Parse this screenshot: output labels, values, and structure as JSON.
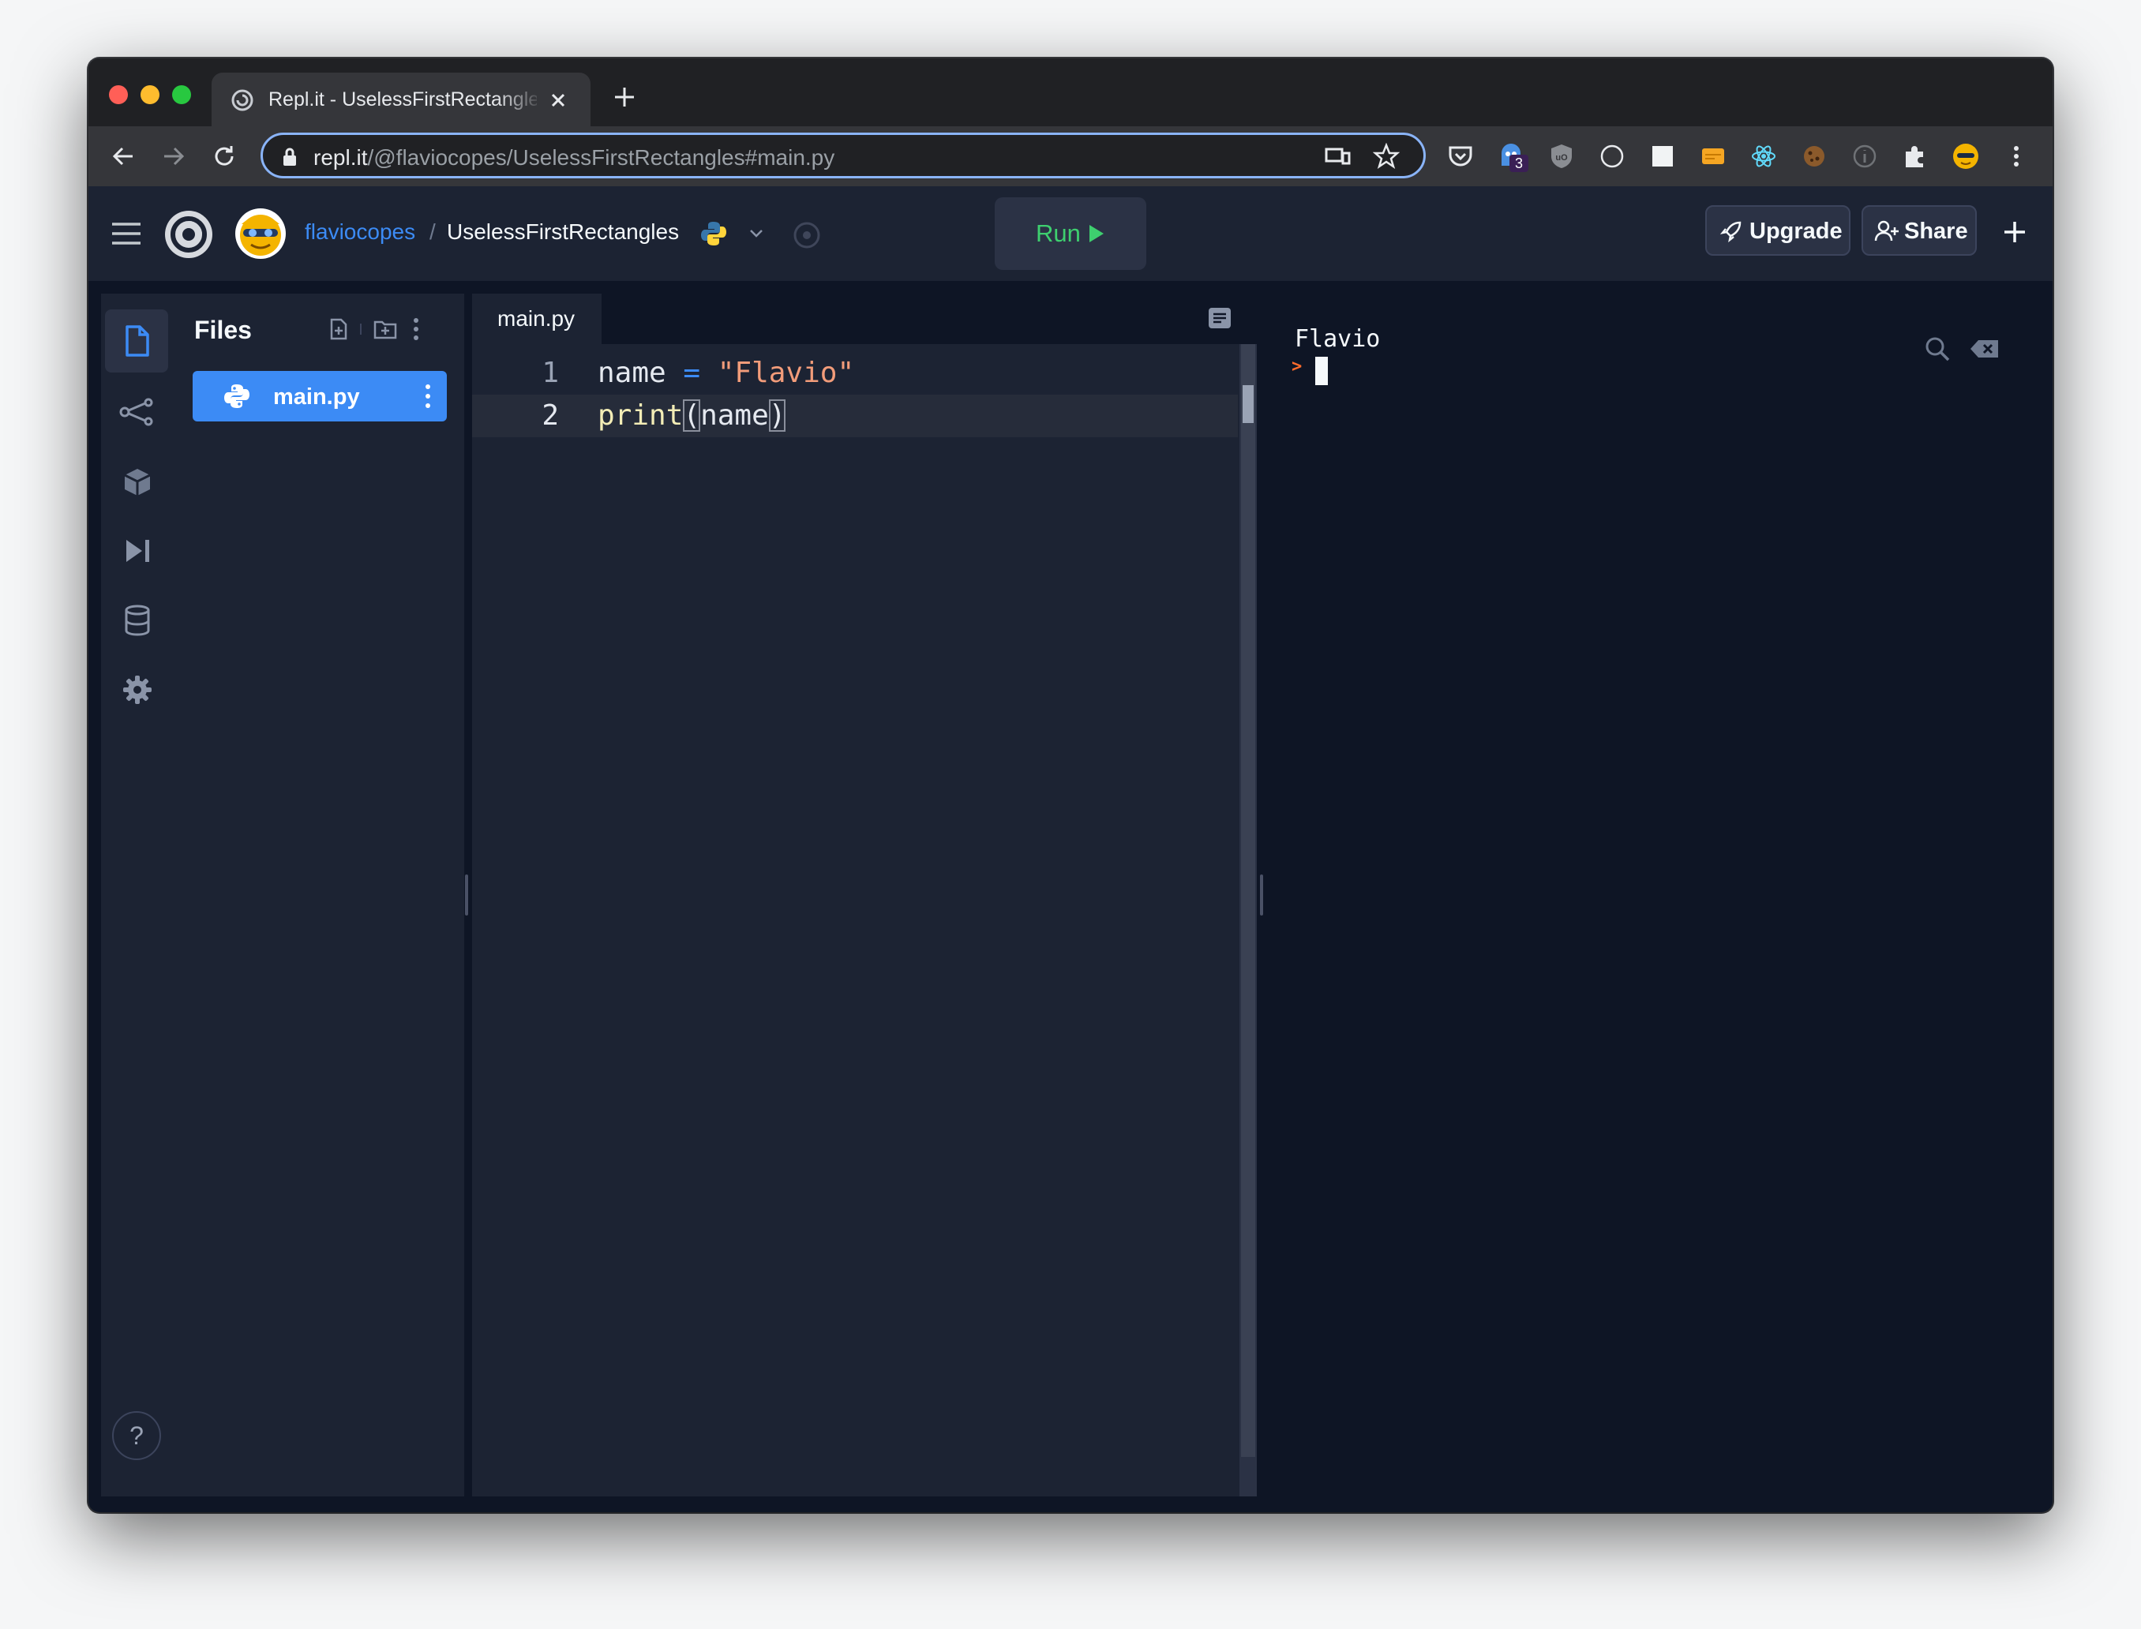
{
  "browser": {
    "tab_title": "Repl.it - UselessFirstRectangles",
    "url_host": "repl.it",
    "url_path": "/@flaviocopes/UselessFirstRectangles#main.py",
    "extension_badge": "3"
  },
  "header": {
    "owner": "flaviocopes",
    "separator": "/",
    "repl_name": "UselessFirstRectangles",
    "run_label": "Run",
    "upgrade_label": "Upgrade",
    "share_label": "Share"
  },
  "files_panel": {
    "title": "Files",
    "files": [
      {
        "name": "main.py",
        "active": true
      }
    ]
  },
  "editor": {
    "tab_label": "main.py",
    "lines": [
      {
        "number": "1",
        "tokens": [
          "name",
          " = ",
          "\"Flavio\""
        ]
      },
      {
        "number": "2",
        "tokens": [
          "print",
          "(",
          "name",
          ")"
        ]
      }
    ]
  },
  "console": {
    "output": "Flavio",
    "prompt": ">"
  },
  "sidebar": {
    "help_label": "?"
  },
  "colors": {
    "accent": "#3c8bf5",
    "run_green": "#3ecf6f",
    "string": "#f29c7a",
    "function": "#f3edb6",
    "prompt": "#ff6b2b"
  }
}
